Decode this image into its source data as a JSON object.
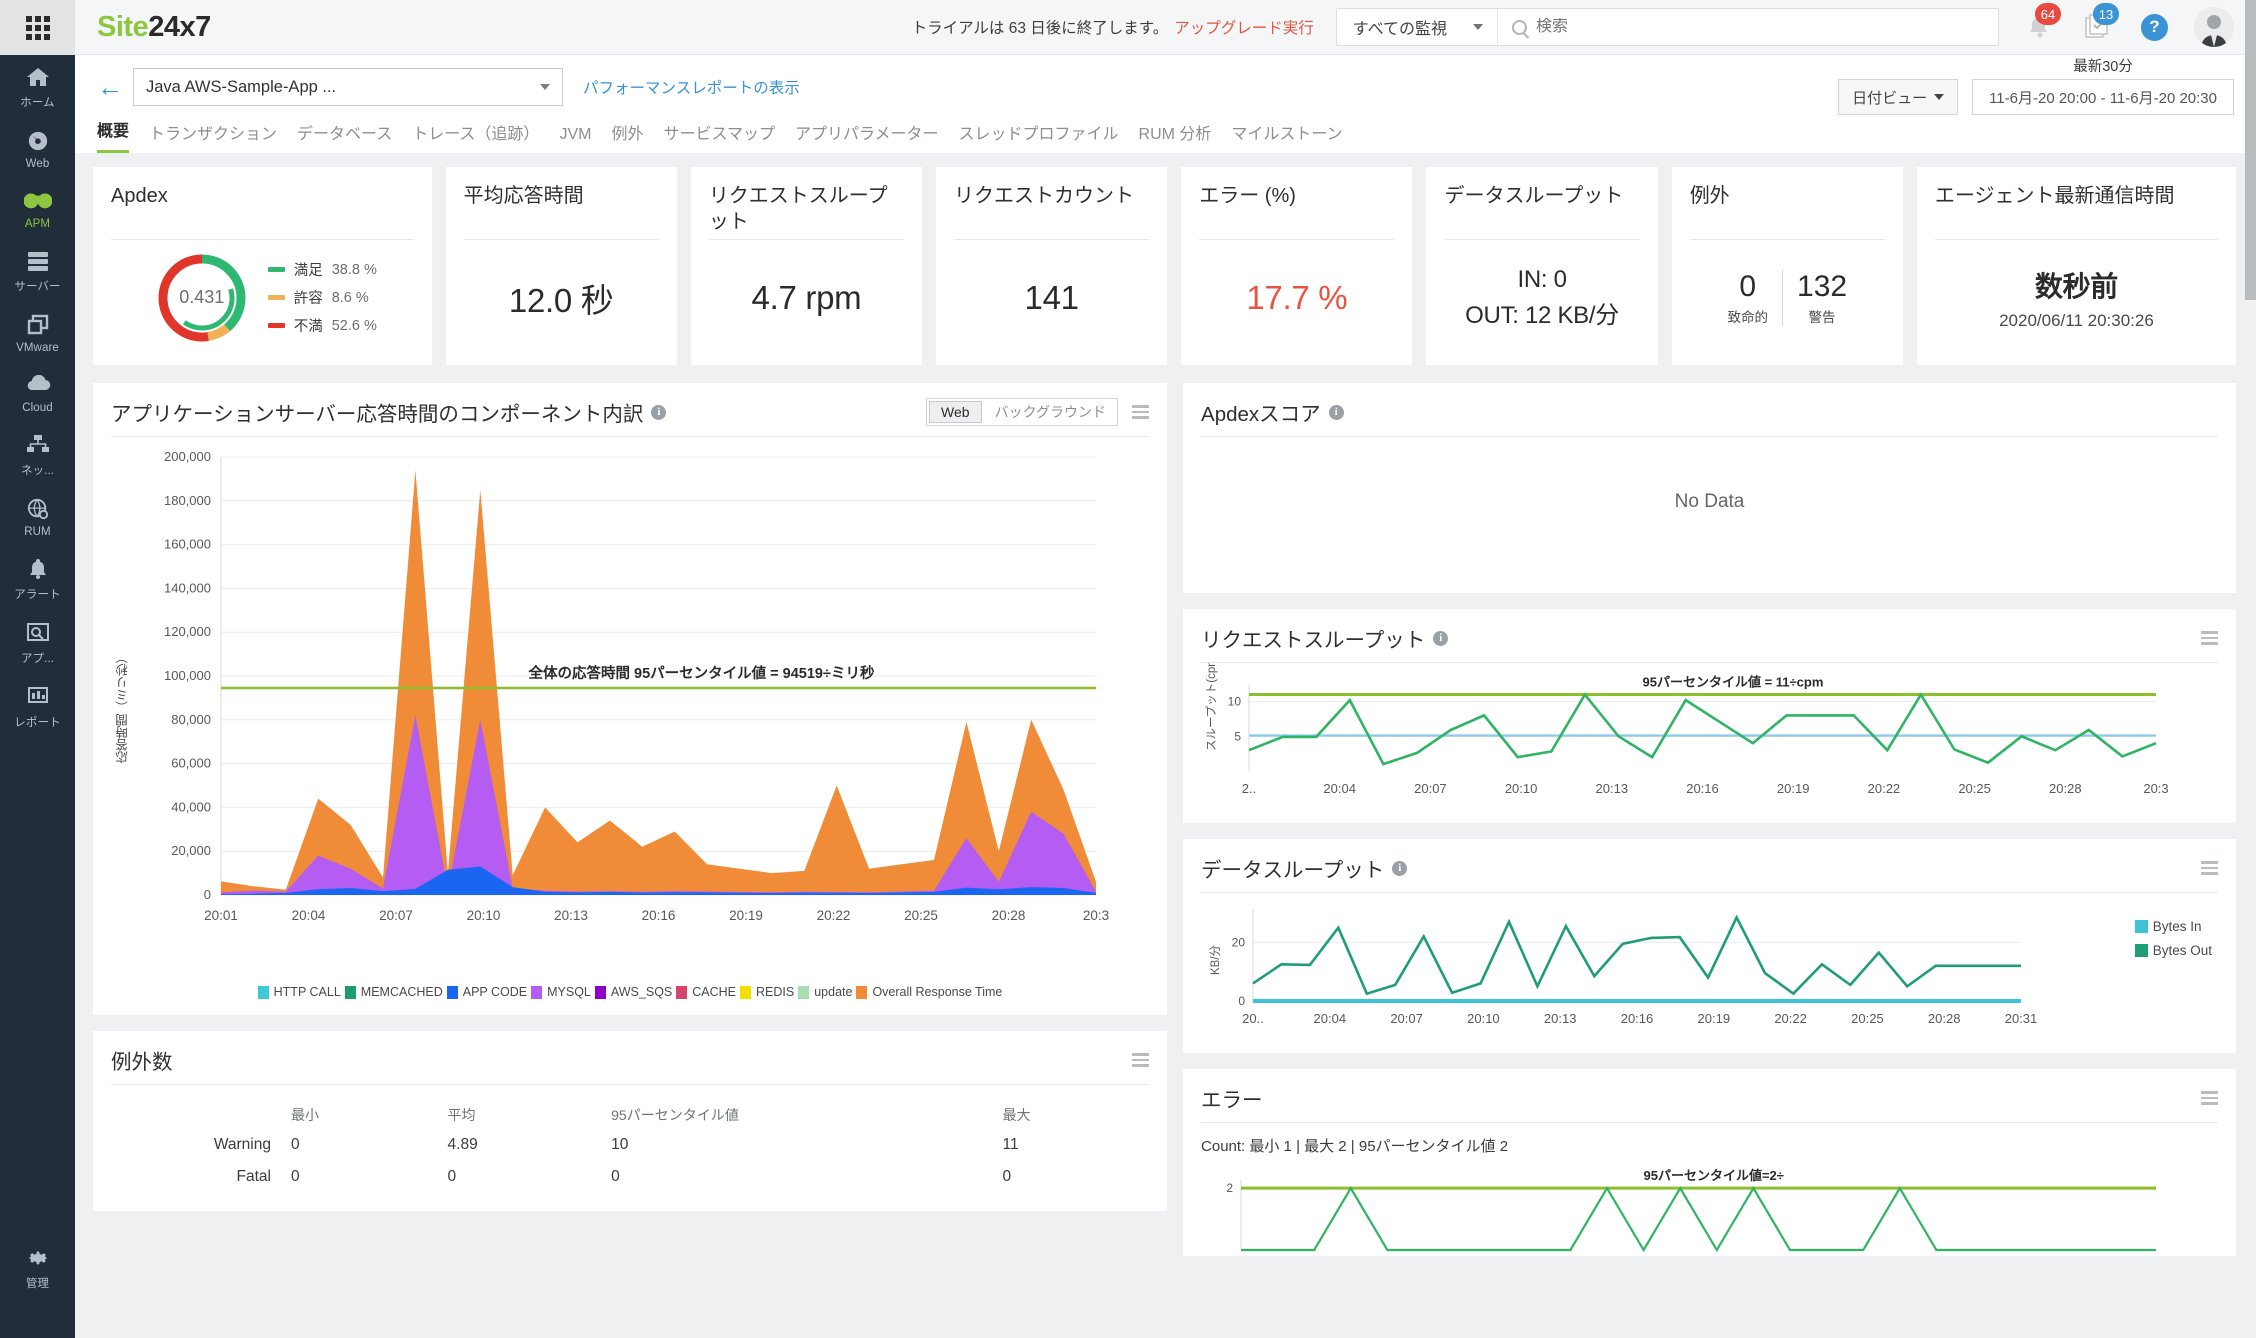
{
  "brand": {
    "part1": "Site",
    "part2": "24x7"
  },
  "topbar": {
    "trial_text": "トライアルは 63 日後に終了します。",
    "upgrade_link": "アップグレード実行",
    "monitor_filter": "すべての監視",
    "search_placeholder": "検索",
    "alerts_badge": "64",
    "tasks_badge": "13",
    "help_label": "?"
  },
  "sidebar": {
    "items": [
      {
        "label": "ホーム",
        "icon": "home-icon"
      },
      {
        "label": "Web",
        "icon": "globe-icon"
      },
      {
        "label": "APM",
        "icon": "binoculars-icon"
      },
      {
        "label": "サーバー",
        "icon": "server-icon"
      },
      {
        "label": "VMware",
        "icon": "vmware-icon"
      },
      {
        "label": "Cloud",
        "icon": "cloud-icon"
      },
      {
        "label": "ネッ...",
        "icon": "network-icon"
      },
      {
        "label": "RUM",
        "icon": "rum-globe-icon"
      },
      {
        "label": "アラート",
        "icon": "bell-icon"
      },
      {
        "label": "アプ...",
        "icon": "app-icon"
      },
      {
        "label": "レポート",
        "icon": "report-icon"
      }
    ],
    "admin": {
      "label": "管理",
      "icon": "gear-icon"
    },
    "active_index": 2
  },
  "pagehead": {
    "app_name": "Java AWS-Sample-App ...",
    "perf_report_link": "パフォーマンスレポートの表示",
    "date_view_label": "日付ビュー",
    "range_label": "最新30分",
    "range_value": "11-6月-20 20:00 - 11-6月-20 20:30",
    "tabs": [
      {
        "label": "概要",
        "active": true
      },
      {
        "label": "トランザクション",
        "active": false
      },
      {
        "label": "データベース",
        "active": false
      },
      {
        "label": "トレース（追跡）",
        "active": false
      },
      {
        "label": "JVM",
        "active": false
      },
      {
        "label": "例外",
        "active": false
      },
      {
        "label": "サービスマップ",
        "active": false
      },
      {
        "label": "アプリパラメーター",
        "active": false
      },
      {
        "label": "スレッドプロファイル",
        "active": false
      },
      {
        "label": "RUM 分析",
        "active": false
      },
      {
        "label": "マイルストーン",
        "active": false
      }
    ]
  },
  "kpis": {
    "apdex": {
      "title": "Apdex",
      "score": "0.431",
      "legend": [
        {
          "label": "満足",
          "value": "38.8 %",
          "color": "#2eb872",
          "pct": 38.8
        },
        {
          "label": "許容",
          "value": "8.6 %",
          "color": "#f0b255",
          "pct": 8.6
        },
        {
          "label": "不満",
          "value": "52.6 %",
          "color": "#e0352b",
          "pct": 52.6
        }
      ]
    },
    "avg_response": {
      "title": "平均応答時間",
      "value": "12.0 秒"
    },
    "throughput": {
      "title": "リクエストスループット",
      "value": "4.7 rpm"
    },
    "req_count": {
      "title": "リクエストカウント",
      "value": "141"
    },
    "error_pct": {
      "title": "エラー (%)",
      "value": "17.7 %",
      "color": "#e8543f"
    },
    "data_throughput": {
      "title": "データスループット",
      "in": "IN: 0",
      "out": "OUT: 12 KB/分"
    },
    "exceptions": {
      "title": "例外",
      "fatal_value": "0",
      "fatal_label": "致命的",
      "warn_value": "132",
      "warn_label": "警告"
    },
    "agent": {
      "title": "エージェント最新通信時間",
      "value": "数秒前",
      "timestamp": "2020/06/11 20:30:26"
    }
  },
  "panels": {
    "component_breakdown": {
      "title": "アプリケーションサーバー応答時間のコンポーネント内訳",
      "toggle": [
        {
          "label": "Web",
          "active": true
        },
        {
          "label": "バックグラウンド",
          "active": false
        }
      ]
    },
    "apdex_score": {
      "title": "Apdexスコア",
      "nodata": "No Data"
    },
    "request_throughput": {
      "title": "リクエストスループット"
    },
    "data_throughput": {
      "title": "データスループット"
    },
    "exception_count": {
      "title": "例外数",
      "columns": [
        "",
        "最小",
        "平均",
        "95パーセンタイル値",
        "最大"
      ],
      "rows": [
        {
          "label": "Warning",
          "min": "0",
          "avg": "4.89",
          "p95": "10",
          "max": "11"
        },
        {
          "label": "Fatal",
          "min": "0",
          "avg": "0",
          "p95": "0",
          "max": "0"
        }
      ]
    },
    "errors": {
      "title": "エラー",
      "count_line": "Count:  最小 1  |  最大 2  |  95パーセンタイル値 2"
    }
  },
  "chart_data": [
    {
      "id": "component_breakdown",
      "type": "area",
      "title": "アプリケーションサーバー応答時間のコンポーネント内訳",
      "xlabel": "",
      "ylabel": "応答時間（ミリ秒）",
      "ylim": [
        0,
        200000
      ],
      "yticks": [
        0,
        20000,
        40000,
        60000,
        80000,
        100000,
        120000,
        140000,
        160000,
        180000,
        200000
      ],
      "ytick_labels": [
        "0",
        "20,000",
        "40,000",
        "60,000",
        "80,000",
        "100,000",
        "120,000",
        "140,000",
        "160,000",
        "180,000",
        "200,000"
      ],
      "xtick_labels": [
        "20:01",
        "20:04",
        "20:07",
        "20:10",
        "20:13",
        "20:16",
        "20:19",
        "20:22",
        "20:25",
        "20:28",
        "20:3"
      ],
      "threshold": {
        "label": "全体の応答時間 95パーセンタイル値 = 94519÷ミリ秒",
        "value": 94519,
        "color": "#8dbe2c"
      },
      "legend": [
        {
          "name": "HTTP CALL",
          "color": "#3ec9d6"
        },
        {
          "name": "MEMCACHED",
          "color": "#1a9e6e"
        },
        {
          "name": "APP CODE",
          "color": "#1a66f0"
        },
        {
          "name": "MYSQL",
          "color": "#b55cf2"
        },
        {
          "name": "AWS_SQS",
          "color": "#8e00c7"
        },
        {
          "name": "CACHE",
          "color": "#d6456b"
        },
        {
          "name": "REDIS",
          "color": "#f2e000"
        },
        {
          "name": "update",
          "color": "#a8ddb0"
        },
        {
          "name": "Overall Response Time",
          "color": "#f08c38"
        }
      ],
      "series": [
        {
          "name": "APP CODE",
          "color": "#1a66f0",
          "values": [
            300,
            600,
            900,
            2600,
            3200,
            1800,
            2800,
            11500,
            13000,
            3600,
            1500,
            1200,
            1400,
            1100,
            1300,
            1200,
            1000,
            900,
            1100,
            1000,
            900,
            1200,
            1400,
            3400,
            2600,
            3600,
            3200,
            900
          ]
        },
        {
          "name": "MYSQL",
          "color": "#b55cf2",
          "values": [
            1200,
            2000,
            1600,
            18000,
            12000,
            3000,
            82000,
            3000,
            80000,
            3000,
            2000,
            1600,
            1800,
            1500,
            1800,
            1600,
            1400,
            1300,
            1500,
            1400,
            1300,
            1600,
            2000,
            26000,
            6000,
            38000,
            28000,
            1500
          ]
        },
        {
          "name": "Overall Response Time",
          "color": "#f08c38",
          "values": [
            6200,
            4000,
            2400,
            44000,
            32000,
            8000,
            194000,
            10000,
            185000,
            9000,
            40000,
            24000,
            34000,
            22000,
            29000,
            14000,
            12000,
            10000,
            11000,
            50000,
            12000,
            14000,
            16000,
            79000,
            20000,
            80000,
            48000,
            6000
          ]
        }
      ]
    },
    {
      "id": "request_throughput",
      "type": "line",
      "title": "リクエストスループット",
      "ylabel": "スループット(cpm)",
      "ylim": [
        0,
        11.8
      ],
      "yticks": [
        5,
        10
      ],
      "ytick_labels": [
        "5",
        "10"
      ],
      "xtick_labels": [
        "2..",
        "20:04",
        "20:07",
        "20:10",
        "20:13",
        "20:16",
        "20:19",
        "20:22",
        "20:25",
        "20:28",
        "20:3"
      ],
      "annotation": "95パーセンタイル値 = 11÷cpm",
      "threshold": {
        "value": 11,
        "color": "#8dbe2c"
      },
      "baseline": {
        "value": 5.1,
        "color": "#8ec9ee"
      },
      "series": [
        {
          "name": "cpm",
          "color": "#2eb463",
          "values": [
            3.0,
            4.9,
            4.9,
            10.2,
            1.0,
            2.6,
            5.9,
            8.0,
            2.0,
            2.8,
            11.0,
            5.0,
            2.0,
            10.2,
            7.1,
            4.0,
            8.0,
            8.0,
            8.0,
            3.0,
            11.0,
            3.1,
            1.2,
            5.0,
            3.0,
            5.9,
            2.1,
            4.0
          ]
        }
      ]
    },
    {
      "id": "data_throughput",
      "type": "line",
      "title": "データスループット",
      "ylabel": "KB/分",
      "ylim": [
        0,
        30
      ],
      "yticks": [
        0,
        20
      ],
      "ytick_labels": [
        "0",
        "20"
      ],
      "xtick_labels": [
        "20..",
        "20:04",
        "20:07",
        "20:10",
        "20:13",
        "20:16",
        "20:19",
        "20:22",
        "20:25",
        "20:28",
        "20:31"
      ],
      "legend_position": "right",
      "series": [
        {
          "name": "Bytes In",
          "color": "#3ec2d6",
          "values": [
            0,
            0,
            0,
            0,
            0,
            0,
            0,
            0,
            0,
            0,
            0,
            0,
            0,
            0,
            0,
            0,
            0,
            0,
            0,
            0,
            0,
            0,
            0,
            0,
            0,
            0,
            0,
            0
          ]
        },
        {
          "name": "Bytes Out",
          "color": "#1f9e76",
          "values": [
            6,
            12.5,
            12.3,
            25,
            2.5,
            5.5,
            22,
            2.8,
            6,
            27,
            5,
            25.5,
            8.5,
            19.5,
            21.5,
            21.8,
            8,
            28.5,
            9.5,
            2.5,
            12.5,
            5.5,
            16.5,
            5,
            12,
            12,
            12,
            12
          ]
        }
      ]
    },
    {
      "id": "errors",
      "type": "line",
      "title": "エラー",
      "ylim": [
        0,
        2.2
      ],
      "yticks": [
        2
      ],
      "ytick_labels": [
        "2"
      ],
      "annotation": "95パーセンタイル値=2÷",
      "threshold": {
        "value": 2,
        "color": "#8dbe2c"
      },
      "stats": {
        "min": 1,
        "max": 2,
        "p95": 2
      },
      "series": [
        {
          "name": "errors",
          "color": "#2eb463",
          "values": [
            0,
            0,
            0,
            2,
            0,
            0,
            0,
            0,
            0,
            0,
            2,
            0,
            2,
            0,
            2,
            0,
            0,
            0,
            2,
            0,
            0,
            0,
            0,
            0,
            0,
            0
          ]
        }
      ]
    }
  ]
}
